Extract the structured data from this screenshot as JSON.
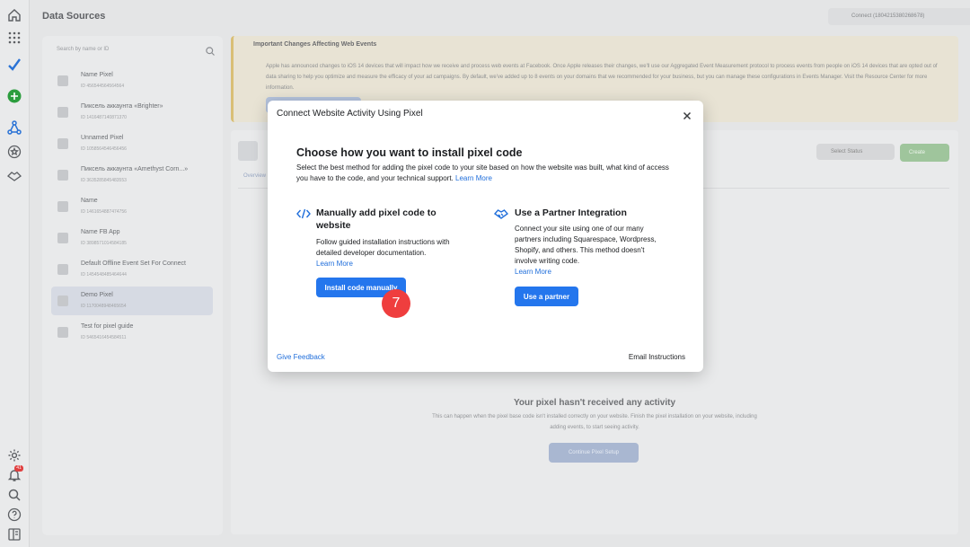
{
  "header": {
    "title": "Data Sources",
    "account": "Connect (1804215380268678)"
  },
  "sidebar": {
    "search_placeholder": "Search by name or ID",
    "notification_count": "41",
    "sources": [
      {
        "name": "Name Pixel",
        "id": "ID 456544564564564"
      },
      {
        "name": "Пиксель аккаунта «Brighter»",
        "id": "ID 1416487140871370"
      },
      {
        "name": "Unnamed Pixel",
        "id": "ID 1058564546456456"
      },
      {
        "name": "Пиксель аккаунта «Amethyst Corn...»",
        "id": "ID 3635285845483553"
      },
      {
        "name": "Name",
        "id": "ID 1461654887474756"
      },
      {
        "name": "Name FB App",
        "id": "ID 3898571014584185"
      },
      {
        "name": "Default Offline Event Set For Connect",
        "id": "ID 1454548485464644"
      },
      {
        "name": "Demo Pixel",
        "id": "ID 1170048948465654"
      },
      {
        "name": "Test for pixel guide",
        "id": "ID 5465416454584511"
      }
    ]
  },
  "banner": {
    "title": "Important Changes Affecting Web Events",
    "body": "Apple has announced changes to iOS 14 devices that will impact how we receive and process web events at Facebook. Once Apple releases their changes, we'll use our Aggregated Event Measurement protocol to process events from people on iOS 14 devices that are opted out of data sharing to help you optimize and measure the efficacy of your ad campaigns. By default, we've added up to 8 events on your domains that we recommended for your business, but you can manage these configurations in Events Manager. Visit the Resource Center for more information."
  },
  "main": {
    "status_filter": "Select Status",
    "create_label": "Create",
    "tab_overview": "Overview",
    "empty_title": "Your pixel hasn't received any activity",
    "empty_desc": "This can happen when the pixel base code isn't installed correctly on your website. Finish the pixel installation on your website, including adding events, to start seeing activity.",
    "empty_button": "Continue Pixel Setup"
  },
  "modal": {
    "title": "Connect Website Activity Using Pixel",
    "heading": "Choose how you want to install pixel code",
    "description": "Select the best method for adding the pixel code to your site based on how the website was built, what kind of access you have to the code, and your technical support.",
    "learn_more": "Learn More",
    "manual": {
      "title": "Manually add pixel code to website",
      "desc": "Follow guided installation instructions with detailed developer documentation.",
      "link": "Learn More",
      "button": "Install code manually",
      "icon": "code-icon"
    },
    "partner": {
      "title": "Use a Partner Integration",
      "desc": "Connect your site using one of our many partners including Squarespace, Wordpress, Shopify, and others. This method doesn't involve writing code.",
      "link": "Learn More",
      "button": "Use a partner",
      "icon": "handshake-icon"
    },
    "feedback": "Give Feedback",
    "email": "Email Instructions"
  },
  "step_marker": "7",
  "colors": {
    "accent": "#2476ed",
    "link": "#216fdb",
    "step": "#ef3e3e"
  }
}
